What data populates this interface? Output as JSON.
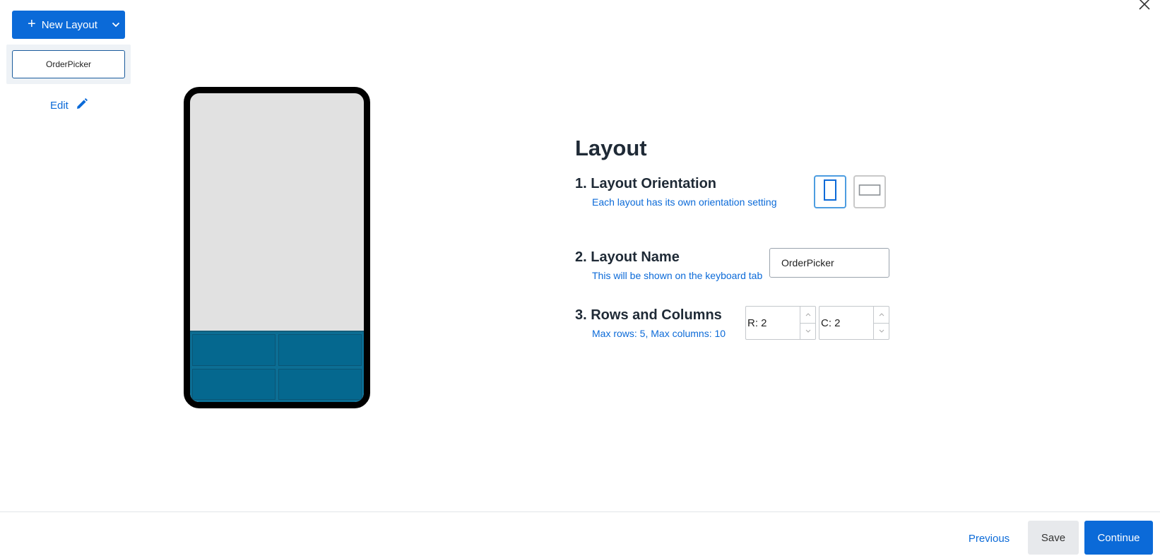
{
  "left_panel": {
    "new_layout_label": "New Layout",
    "layouts": [
      {
        "label": "OrderPicker",
        "selected": true
      }
    ],
    "edit_label": "Edit"
  },
  "preview": {
    "orientation": "portrait",
    "rows": 2,
    "columns": 2
  },
  "form": {
    "title": "Layout",
    "orientation": {
      "heading": "1. Layout Orientation",
      "subtext": "Each layout has its own orientation setting",
      "selected": "portrait"
    },
    "name": {
      "heading": "2. Layout Name",
      "subtext": "This will be shown on the keyboard tab",
      "value": "OrderPicker"
    },
    "grid": {
      "heading": "3. Rows and Columns",
      "subtext": "Max rows: 5, Max columns: 10",
      "rows_display": "R: 2",
      "cols_display": "C: 2"
    }
  },
  "footer": {
    "previous_label": "Previous",
    "save_label": "Save",
    "continue_label": "Continue"
  },
  "colors": {
    "accent": "#0b6ad8",
    "grid_fill": "#05688f",
    "phone_frame": "#000000",
    "phone_screen": "#e1e1e1"
  },
  "icons": {
    "close": "close-icon",
    "plus": "plus-icon",
    "chevron": "chevron-down-icon",
    "edit": "pencil-icon"
  }
}
